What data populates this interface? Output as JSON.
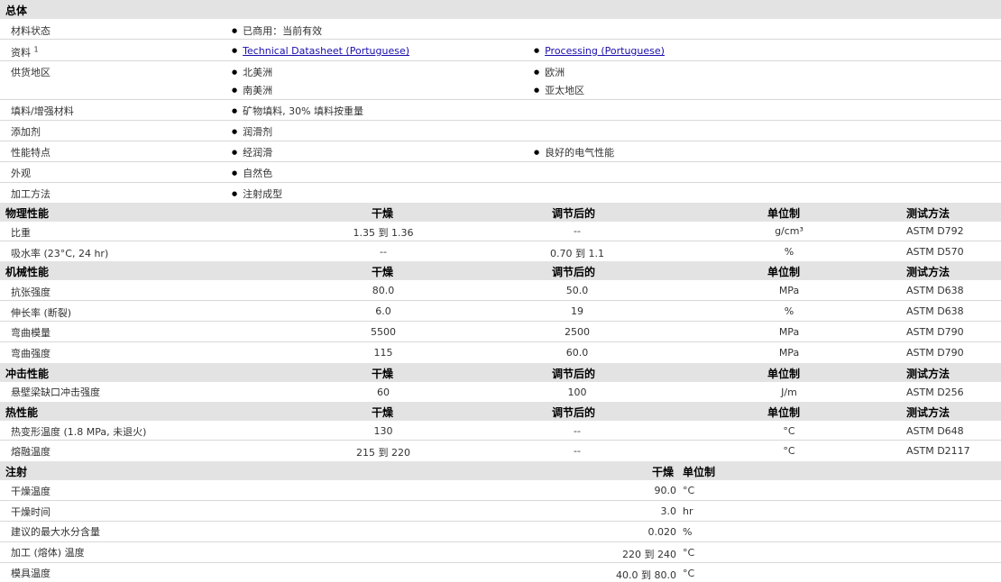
{
  "general": {
    "title": "总体",
    "rows": [
      {
        "label": "材料状态",
        "v1": "已商用：当前有效"
      },
      {
        "label": "资料",
        "sup": "1",
        "link1": "Technical Datasheet (Portuguese)",
        "link2": "Processing (Portuguese)"
      },
      {
        "label": "供货地区",
        "v1": "北美洲",
        "v2": "欧洲",
        "v3": "南美洲",
        "v4": "亚太地区"
      },
      {
        "label": "填料/增强材料",
        "v1": "矿物填料, 30% 填料按重量"
      },
      {
        "label": "添加剂",
        "v1": "润滑剂"
      },
      {
        "label": "性能特点",
        "v1": "经润滑",
        "v2": "良好的电气性能"
      },
      {
        "label": "外观",
        "v1": "自然色"
      },
      {
        "label": "加工方法",
        "v1": "注射成型"
      }
    ]
  },
  "columns": {
    "dry": "干燥",
    "cond": "调节后的",
    "unit": "单位制",
    "method": "测试方法"
  },
  "physical": {
    "title": "物理性能",
    "rows": [
      {
        "label": "比重",
        "dry": "1.35 到 1.36",
        "cond": "--",
        "unit": "g/cm³",
        "method": "ASTM D792"
      },
      {
        "label": "吸水率 (23°C, 24 hr)",
        "dry": "--",
        "cond": "0.70 到 1.1",
        "unit": "%",
        "method": "ASTM D570"
      }
    ]
  },
  "mechanical": {
    "title": "机械性能",
    "rows": [
      {
        "label": "抗张强度",
        "dry": "80.0",
        "cond": "50.0",
        "unit": "MPa",
        "method": "ASTM D638"
      },
      {
        "label": "伸长率 (断裂)",
        "dry": "6.0",
        "cond": "19",
        "unit": "%",
        "method": "ASTM D638"
      },
      {
        "label": "弯曲模量",
        "dry": "5500",
        "cond": "2500",
        "unit": "MPa",
        "method": "ASTM D790"
      },
      {
        "label": "弯曲强度",
        "dry": "115",
        "cond": "60.0",
        "unit": "MPa",
        "method": "ASTM D790"
      }
    ]
  },
  "impact": {
    "title": "冲击性能",
    "rows": [
      {
        "label": "悬壁梁缺口冲击强度",
        "dry": "60",
        "cond": "100",
        "unit": "J/m",
        "method": "ASTM D256"
      }
    ]
  },
  "thermal": {
    "title": "热性能",
    "rows": [
      {
        "label": "热变形温度 (1.8 MPa, 未退火)",
        "dry": "130",
        "cond": "--",
        "unit": "°C",
        "method": "ASTM D648"
      },
      {
        "label": "熔融温度",
        "dry": "215 到 220",
        "cond": "--",
        "unit": "°C",
        "method": "ASTM D2117"
      }
    ]
  },
  "injection": {
    "title": "注射",
    "dry": "干燥",
    "unit": "单位制",
    "rows": [
      {
        "label": "干燥温度",
        "value": "90.0",
        "unit": "°C"
      },
      {
        "label": "干燥时间",
        "value": "3.0",
        "unit": "hr"
      },
      {
        "label": "建议的最大水分含量",
        "value": "0.020",
        "unit": "%"
      },
      {
        "label": "加工 (熔体) 温度",
        "value": "220 到 240",
        "unit": "°C"
      },
      {
        "label": "模具温度",
        "value": "40.0 到 80.0",
        "unit": "°C"
      }
    ]
  }
}
